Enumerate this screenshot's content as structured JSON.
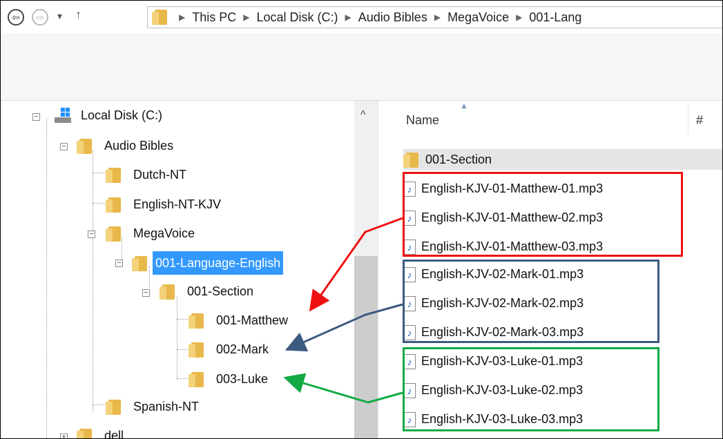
{
  "breadcrumb": [
    "This PC",
    "Local Disk (C:)",
    "Audio Bibles",
    "MegaVoice",
    "001-Lang"
  ],
  "nav": {
    "back": "⇦",
    "forward": "⇨",
    "dropdown": "▾",
    "up": "↑"
  },
  "tree": {
    "local_disk": "Local Disk (C:)",
    "audio_bibles": "Audio Bibles",
    "dutch": "Dutch-NT",
    "english_kjv": "English-NT-KJV",
    "megavoice": "MegaVoice",
    "language_english": "001-Language-English",
    "section": "001-Section",
    "matthew": "001-Matthew",
    "mark": "002-Mark",
    "luke": "003-Luke",
    "spanish": "Spanish-NT",
    "dell": "dell"
  },
  "columns": {
    "name": "Name",
    "number": "#"
  },
  "files": [
    "001-Section",
    "English-KJV-01-Matthew-01.mp3",
    "English-KJV-01-Matthew-02.mp3",
    "English-KJV-01-Matthew-03.mp3",
    "English-KJV-02-Mark-01.mp3",
    "English-KJV-02-Mark-02.mp3",
    "English-KJV-02-Mark-03.mp3",
    "English-KJV-03-Luke-01.mp3",
    "English-KJV-03-Luke-02.mp3",
    "English-KJV-03-Luke-03.mp3"
  ],
  "colors": {
    "red": "#ee1111",
    "blue": "#3d5a80",
    "green": "#11aa44",
    "selection": "#3399ff"
  }
}
